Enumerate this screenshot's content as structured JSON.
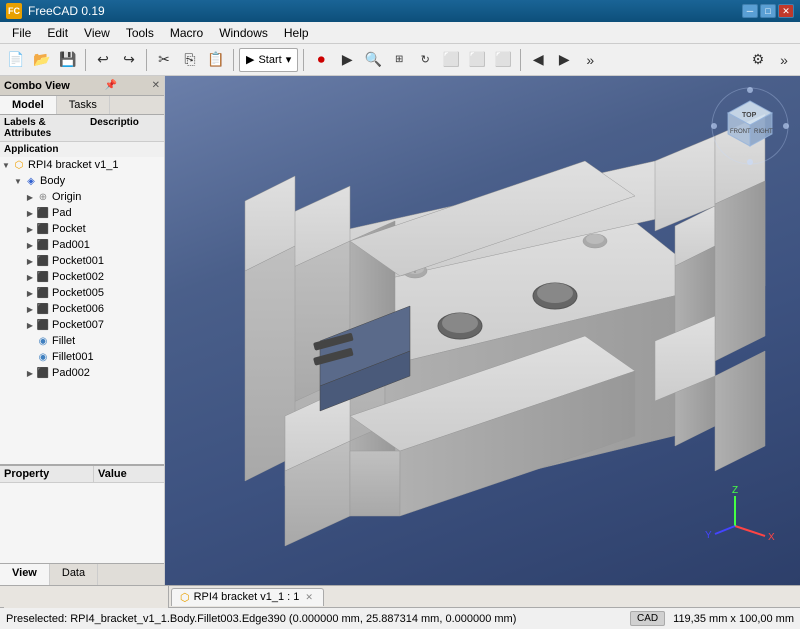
{
  "titleBar": {
    "title": "FreeCAD 0.19",
    "icon": "FC",
    "controls": [
      "minimize",
      "maximize",
      "close"
    ]
  },
  "menuBar": {
    "items": [
      "File",
      "Edit",
      "View",
      "Tools",
      "Macro",
      "Windows",
      "Help"
    ]
  },
  "toolbar1": {
    "dropdown": "Start",
    "buttons": [
      "new",
      "open",
      "save",
      "undo",
      "redo",
      "cut",
      "copy",
      "paste",
      "refresh"
    ]
  },
  "toolbar2": {
    "buttons": [
      "zoom-in",
      "zoom-out",
      "zoom-fit",
      "rotate",
      "pan",
      "view-front",
      "view-top",
      "view-right",
      "view-iso",
      "nav-prev",
      "nav-next"
    ]
  },
  "leftPanel": {
    "header": "Combo View",
    "tabs": [
      {
        "label": "Model",
        "active": true
      },
      {
        "label": "Tasks",
        "active": false
      }
    ],
    "treeHeader": {
      "col1": "Labels & Attributes",
      "col2": "Descriptio"
    },
    "sectionLabel": "Application",
    "treeItems": [
      {
        "id": "rpi4bracket",
        "label": "RPI4 bracket v1_1",
        "level": 0,
        "expanded": true,
        "icon": "folder",
        "hasArrow": true
      },
      {
        "id": "body",
        "label": "Body",
        "level": 1,
        "expanded": true,
        "icon": "body",
        "hasArrow": true
      },
      {
        "id": "origin",
        "label": "Origin",
        "level": 2,
        "expanded": false,
        "icon": "origin",
        "hasArrow": true
      },
      {
        "id": "pad",
        "label": "Pad",
        "level": 2,
        "expanded": false,
        "icon": "feature",
        "hasArrow": true
      },
      {
        "id": "pocket",
        "label": "Pocket",
        "level": 2,
        "expanded": false,
        "icon": "feature",
        "hasArrow": true
      },
      {
        "id": "pad001",
        "label": "Pad001",
        "level": 2,
        "expanded": false,
        "icon": "feature",
        "hasArrow": true
      },
      {
        "id": "pocket001",
        "label": "Pocket001",
        "level": 2,
        "expanded": false,
        "icon": "feature",
        "hasArrow": true
      },
      {
        "id": "pocket002",
        "label": "Pocket002",
        "level": 2,
        "expanded": false,
        "icon": "feature",
        "hasArrow": true
      },
      {
        "id": "pocket005",
        "label": "Pocket005",
        "level": 2,
        "expanded": false,
        "icon": "feature",
        "hasArrow": true
      },
      {
        "id": "pocket006",
        "label": "Pocket006",
        "level": 2,
        "expanded": false,
        "icon": "feature",
        "hasArrow": true
      },
      {
        "id": "pocket007",
        "label": "Pocket007",
        "level": 2,
        "expanded": false,
        "icon": "feature",
        "hasArrow": true
      },
      {
        "id": "fillet",
        "label": "Fillet",
        "level": 2,
        "expanded": false,
        "icon": "fillet",
        "hasArrow": false
      },
      {
        "id": "fillet001",
        "label": "Fillet001",
        "level": 2,
        "expanded": false,
        "icon": "fillet",
        "hasArrow": false
      },
      {
        "id": "pad002",
        "label": "Pad002",
        "level": 2,
        "expanded": false,
        "icon": "feature",
        "hasArrow": true
      }
    ],
    "propertySection": {
      "col1": "Property",
      "col2": "Value"
    },
    "bottomTabs": [
      {
        "label": "View",
        "active": true
      },
      {
        "label": "Data",
        "active": false
      }
    ]
  },
  "viewport": {
    "documentTab": {
      "label": "RPI4 bracket v1_1 : 1",
      "icon": "doc"
    }
  },
  "statusBar": {
    "message": "Preselected: RPI4_bracket_v1_1.Body.Fillet003.Edge390 (0.000000 mm, 25.887314 mm, 0.000000 mm)",
    "cad": "CAD",
    "coords": "119,35 mm x 100,00 mm"
  }
}
